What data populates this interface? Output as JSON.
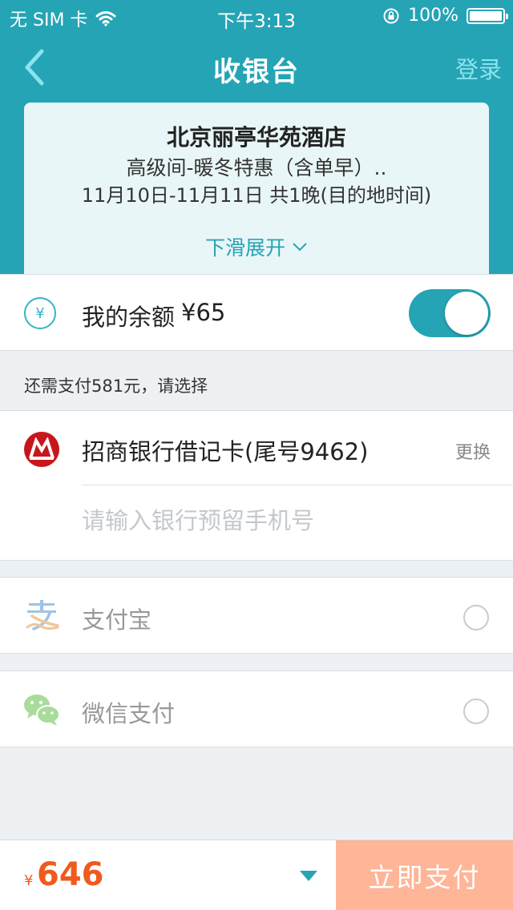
{
  "status_bar": {
    "carrier": "无 SIM 卡",
    "time": "下午3:13",
    "battery": "100%",
    "icons": [
      "wifi-icon",
      "orientation-lock-icon",
      "battery-icon"
    ]
  },
  "nav": {
    "title": "收银台",
    "login": "登录",
    "back_icon": "chevron-left-icon"
  },
  "order": {
    "hotel": "北京丽亭华苑酒店",
    "room": "高级间-暖冬特惠（含单早）..",
    "dates": "11月10日-11月11日 共1晚(目的地时间)",
    "expand": "下滑展开"
  },
  "balance": {
    "label": "我的余额",
    "amount": "¥65",
    "toggle_on": true
  },
  "remaining": "还需支付581元，请选择",
  "bank_card": {
    "name": "招商银行借记卡(尾号9462)",
    "change": "更换",
    "phone_placeholder": "请输入银行预留手机号"
  },
  "options": {
    "alipay": "支付宝",
    "wechat": "微信支付"
  },
  "footer": {
    "currency": "¥",
    "total": "646",
    "pay_button": "立即支付"
  },
  "colors": {
    "primary": "#25a4b5",
    "price": "#f05a1e",
    "pay_button": "#ffb598",
    "bank_logo": "#c8161d"
  }
}
